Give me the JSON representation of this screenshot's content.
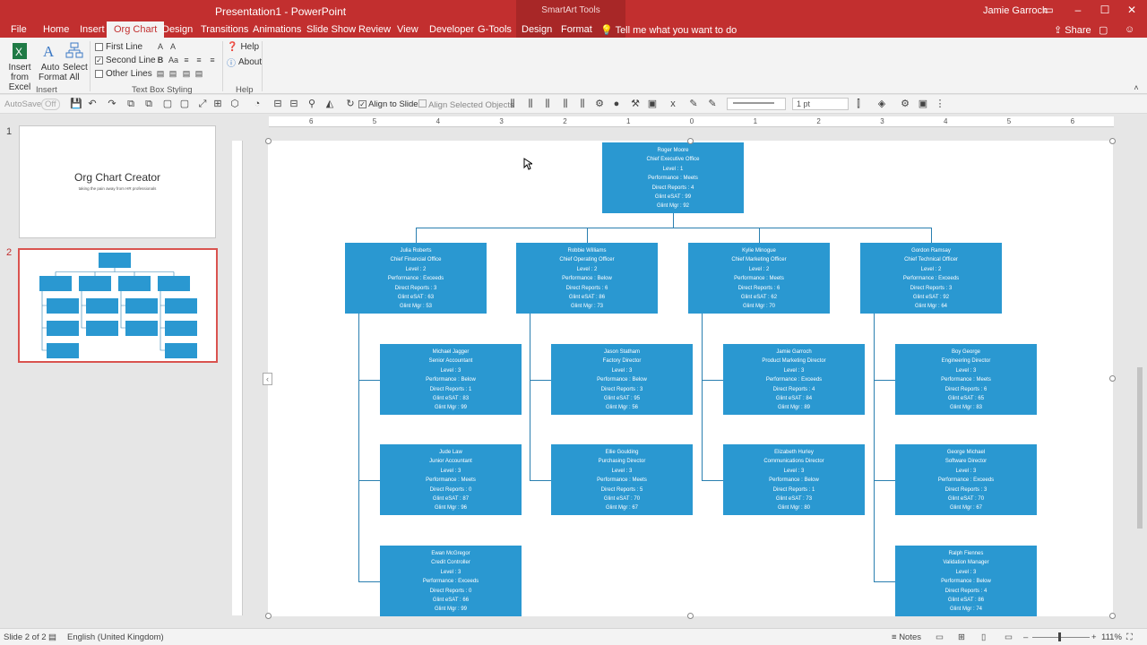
{
  "window": {
    "title": "Presentation1 - PowerPoint",
    "context_label": "SmartArt Tools",
    "user": "Jamie Garroch"
  },
  "tabs": [
    "File",
    "Home",
    "Insert",
    "Org Chart",
    "Design",
    "Transitions",
    "Animations",
    "Slide Show",
    "Review",
    "View",
    "Developer",
    "G-Tools",
    "Design",
    "Format"
  ],
  "active_tab_index": 3,
  "tell_me": "Tell me what you want to do",
  "share": "Share",
  "ribbon": {
    "insert_from_excel": "Insert\nfrom Excel",
    "auto_format": "Auto\nFormat",
    "select_all": "Select\nAll",
    "insert_group": "Insert",
    "first_line": "First Line",
    "second_line": "Second Line",
    "other_lines": "Other Lines",
    "text_box_group": "Text Box Styling",
    "help": "Help",
    "about": "About",
    "help_group": "Help"
  },
  "quickbar": {
    "autosave": "AutoSave",
    "autosave_state": "Off",
    "align_to_slide": "Align to Slide",
    "align_selected": "Align Selected Objects",
    "weight": "1 pt"
  },
  "slides": [
    {
      "num": "1",
      "title": "Org Chart Creator",
      "subtitle": "taking the pain away from HR professionals"
    },
    {
      "num": "2"
    }
  ],
  "hruler_labels": [
    "6",
    "5",
    "4",
    "3",
    "2",
    "1",
    "0",
    "1",
    "2",
    "3",
    "4",
    "5",
    "6"
  ],
  "org": {
    "root": {
      "name": "Roger Moore",
      "title": "Chief Executive Office",
      "level": "Level : 1",
      "perf": "Performance : Meets",
      "reports": "Direct Reports : 4",
      "esat": "Glint eSAT : 99",
      "mgr": "Glint Mgr : 92"
    },
    "level2": [
      {
        "name": "Julia Roberts",
        "title": "Chief Financial Office",
        "level": "Level : 2",
        "perf": "Performance : Exceeds",
        "reports": "Direct Reports : 3",
        "esat": "Glint eSAT : 63",
        "mgr": "Glint Mgr : 53"
      },
      {
        "name": "Robbie Williams",
        "title": "Chief Operating Officer",
        "level": "Level : 2",
        "perf": "Performance : Below",
        "reports": "Direct Reports : 6",
        "esat": "Glint eSAT : 86",
        "mgr": "Glint Mgr : 73"
      },
      {
        "name": "Kylie Minogue",
        "title": "Chief Marketing Officer",
        "level": "Level : 2",
        "perf": "Performance : Meets",
        "reports": "Direct Reports : 6",
        "esat": "Glint eSAT : 62",
        "mgr": "Glint Mgr : 70"
      },
      {
        "name": "Gordon Ramsay",
        "title": "Chief Technical Officer",
        "level": "Level : 2",
        "perf": "Performance : Exceeds",
        "reports": "Direct Reports : 3",
        "esat": "Glint eSAT : 92",
        "mgr": "Glint Mgr : 64"
      }
    ],
    "level3": [
      [
        {
          "name": "Michael Jagger",
          "title": "Senior Accountant",
          "level": "Level : 3",
          "perf": "Performance : Below",
          "reports": "Direct Reports : 1",
          "esat": "Glint eSAT : 83",
          "mgr": "Glint Mgr : 99"
        },
        {
          "name": "Jude Law",
          "title": "Junior Accountant",
          "level": "Level : 3",
          "perf": "Performance : Meets",
          "reports": "Direct Reports : 0",
          "esat": "Glint eSAT : 87",
          "mgr": "Glint Mgr : 96"
        },
        {
          "name": "Ewan McGregor",
          "title": "Credit Controller",
          "level": "Level : 3",
          "perf": "Performance : Exceeds",
          "reports": "Direct Reports : 0",
          "esat": "Glint eSAT : 66",
          "mgr": "Glint Mgr : 99"
        }
      ],
      [
        {
          "name": "Jason Statham",
          "title": "Factory Director",
          "level": "Level : 3",
          "perf": "Performance : Below",
          "reports": "Direct Reports : 3",
          "esat": "Glint eSAT : 95",
          "mgr": "Glint Mgr : 56"
        },
        {
          "name": "Ellie Goulding",
          "title": "Purchasing Director",
          "level": "Level : 3",
          "perf": "Performance : Meets",
          "reports": "Direct Reports : 5",
          "esat": "Glint eSAT : 70",
          "mgr": "Glint Mgr : 67"
        }
      ],
      [
        {
          "name": "Jamie Garroch",
          "title": "Product Marketing Director",
          "level": "Level : 3",
          "perf": "Performance : Exceeds",
          "reports": "Direct Reports : 4",
          "esat": "Glint eSAT : 84",
          "mgr": "Glint Mgr : 89"
        },
        {
          "name": "Elizabeth Hurley",
          "title": "Communications Director",
          "level": "Level : 3",
          "perf": "Performance : Below",
          "reports": "Direct Reports : 1",
          "esat": "Glint eSAT : 73",
          "mgr": "Glint Mgr : 80"
        }
      ],
      [
        {
          "name": "Boy George",
          "title": "Engineering Director",
          "level": "Level : 3",
          "perf": "Performance : Meets",
          "reports": "Direct Reports : 6",
          "esat": "Glint eSAT : 65",
          "mgr": "Glint Mgr : 83"
        },
        {
          "name": "George Michael",
          "title": "Software Director",
          "level": "Level : 3",
          "perf": "Performance : Exceeds",
          "reports": "Direct Reports : 3",
          "esat": "Glint eSAT : 70",
          "mgr": "Glint Mgr : 67"
        },
        {
          "name": "Ralph Fiennes",
          "title": "Validation Manager",
          "level": "Level : 3",
          "perf": "Performance : Below",
          "reports": "Direct Reports : 4",
          "esat": "Glint eSAT : 86",
          "mgr": "Glint Mgr : 74"
        }
      ]
    ]
  },
  "status": {
    "slide": "Slide 2 of 2",
    "language": "English (United Kingdom)",
    "notes": "Notes",
    "zoom": "111%"
  },
  "colors": {
    "accent": "#c22f2f",
    "node": "#2a98d1"
  }
}
